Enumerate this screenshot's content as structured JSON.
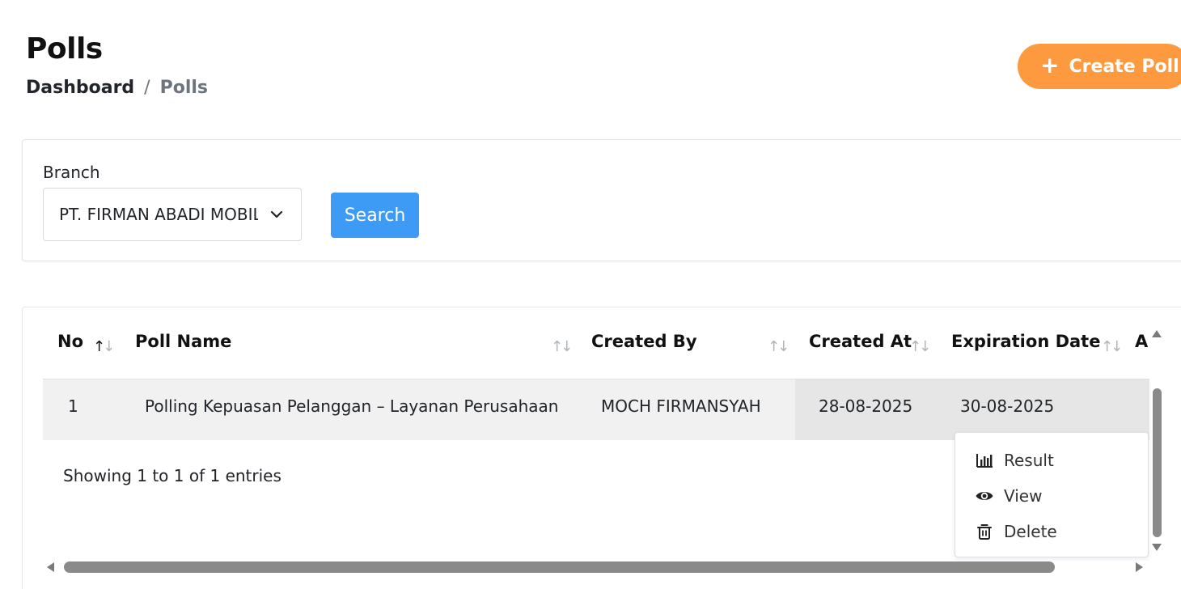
{
  "page": {
    "title": "Polls",
    "breadcrumb": {
      "home": "Dashboard",
      "separator": "/",
      "current": "Polls"
    },
    "create_button": {
      "icon": "plus-icon",
      "label": "Create Poll",
      "color": "#fd9a3f"
    }
  },
  "filter": {
    "branch_label": "Branch",
    "branch_value": "PT. FIRMAN ABADI MOBIL",
    "search_label": "Search",
    "search_color": "#3d9bf6"
  },
  "table": {
    "columns": [
      {
        "label": "No",
        "sort": "asc"
      },
      {
        "label": "Poll Name",
        "sort": "none"
      },
      {
        "label": "Created By",
        "sort": "none"
      },
      {
        "label": "Created At",
        "sort": "none"
      },
      {
        "label": "Expiration Date",
        "sort": "none"
      },
      {
        "label": "A",
        "sort": "none"
      }
    ],
    "rows": [
      {
        "no": "1",
        "poll_name": "Polling Kepuasan Pelanggan – Layanan Perusahaan",
        "created_by": "MOCH FIRMANSYAH",
        "created_at": "28-08-2025",
        "expiration_date": "30-08-2025"
      }
    ],
    "sort_glyph": "↑↓",
    "info": "Showing 1 to 1 of 1 entries"
  },
  "action_menu": {
    "items": [
      {
        "label": "Result",
        "icon": "bar-chart-icon"
      },
      {
        "label": "View",
        "icon": "eye-icon"
      },
      {
        "label": "Delete",
        "icon": "trash-icon"
      }
    ]
  }
}
